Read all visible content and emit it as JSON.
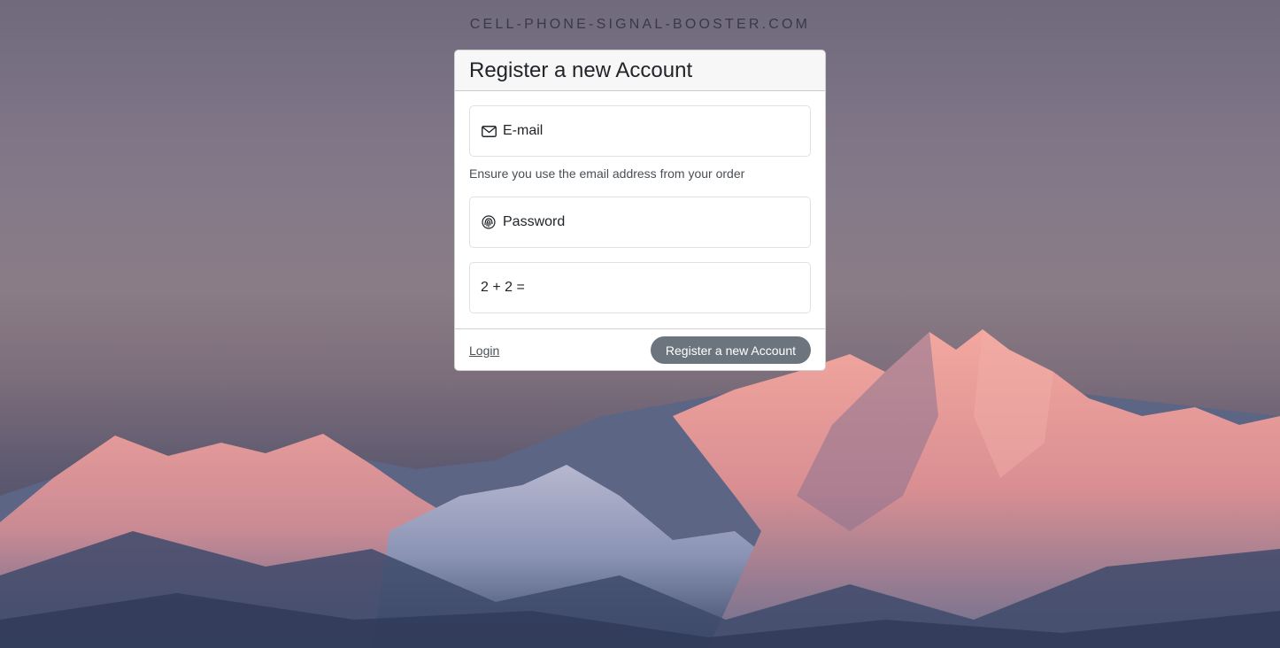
{
  "site": {
    "title": "CELL-PHONE-SIGNAL-BOOSTER.COM"
  },
  "card": {
    "title": "Register a new Account",
    "email": {
      "label": "E-mail",
      "icon": "envelope-icon"
    },
    "hint": "Ensure you use the email address from your order",
    "password": {
      "label": "Password",
      "icon": "fingerprint-icon"
    },
    "captcha": {
      "label": "2 + 2 ="
    },
    "footer": {
      "login_label": "Login",
      "register_label": "Register a new Account"
    }
  },
  "colors": {
    "button": "#6c757d",
    "header_bg": "#f7f7f7",
    "card_bg": "#ffffff"
  }
}
